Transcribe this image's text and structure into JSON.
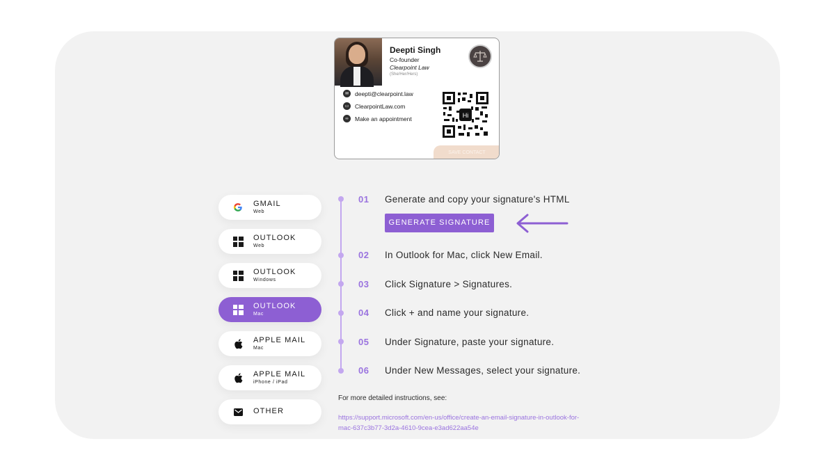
{
  "signature": {
    "name": "Deepti Singh",
    "role": "Co-founder",
    "company": "Clearpoint Law",
    "pronouns": "(She/Her/Hers)",
    "email": "deepti@clearpoint.law",
    "website": "ClearpointLaw.com",
    "appointment": "Make an appointment",
    "qr_badge": "Hi",
    "save_contact": "SAVE CONTACT"
  },
  "clients": [
    {
      "name": "GMAIL",
      "sub": "Web",
      "icon": "google-icon",
      "active": false
    },
    {
      "name": "OUTLOOK",
      "sub": "Web",
      "icon": "windows-icon",
      "active": false
    },
    {
      "name": "OUTLOOK",
      "sub": "Windows",
      "icon": "windows-icon",
      "active": false
    },
    {
      "name": "OUTLOOK",
      "sub": "Mac",
      "icon": "windows-icon",
      "active": true
    },
    {
      "name": "APPLE MAIL",
      "sub": "Mac",
      "icon": "apple-icon",
      "active": false
    },
    {
      "name": "APPLE MAIL",
      "sub": "iPhone / iPad",
      "icon": "apple-icon",
      "active": false
    },
    {
      "name": "OTHER",
      "sub": "",
      "icon": "mail-icon",
      "active": false
    }
  ],
  "steps": [
    {
      "num": "01",
      "text": "Generate and copy your signature's HTML"
    },
    {
      "num": "02",
      "text": "In Outlook for Mac, click New Email."
    },
    {
      "num": "03",
      "text": "Click Signature > Signatures."
    },
    {
      "num": "04",
      "text": "Click + and name your signature."
    },
    {
      "num": "05",
      "text": "Under Signature, paste your signature."
    },
    {
      "num": "06",
      "text": "Under New Messages, select your signature."
    }
  ],
  "generate_button": "GENERATE SIGNATURE",
  "more_instructions": "For more detailed instructions, see:",
  "help_link": "https://support.microsoft.com/en-us/office/create-an-email-signature-in-outlook-for-mac-637c3b77-3d2a-4610-9cea-e3ad622aa54e",
  "colors": {
    "accent": "#8d5fd3",
    "accent_light": "#c3a7ef",
    "panel": "#f2f2f2"
  }
}
